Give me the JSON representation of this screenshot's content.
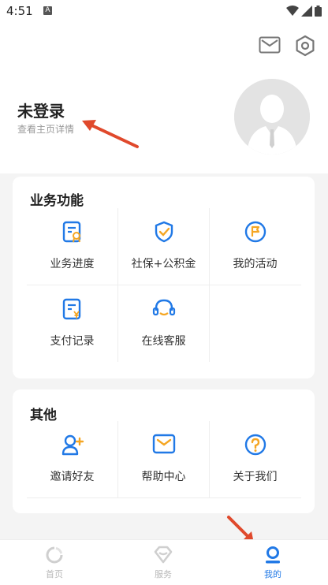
{
  "status_bar": {
    "time": "4:51",
    "a_badge": "A"
  },
  "header": {
    "title": "未登录",
    "subtitle": "查看主页详情"
  },
  "business": {
    "title": "业务功能",
    "items": [
      {
        "label": "业务进度",
        "icon": "certificate-icon"
      },
      {
        "label": "社保+公积金",
        "icon": "shield-check-icon"
      },
      {
        "label": "我的活动",
        "icon": "flag-icon"
      },
      {
        "label": "支付记录",
        "icon": "payment-record-icon"
      },
      {
        "label": "在线客服",
        "icon": "headset-icon"
      }
    ]
  },
  "other": {
    "title": "其他",
    "items": [
      {
        "label": "邀请好友",
        "icon": "add-user-icon"
      },
      {
        "label": "帮助中心",
        "icon": "mail-icon"
      },
      {
        "label": "关于我们",
        "icon": "question-icon"
      }
    ]
  },
  "tabs": [
    {
      "label": "首页",
      "icon": "home-icon",
      "active": false
    },
    {
      "label": "服务",
      "icon": "service-icon",
      "active": false
    },
    {
      "label": "我的",
      "icon": "profile-icon",
      "active": true
    }
  ],
  "colors": {
    "primary": "#2179e6",
    "accent": "#f5a623",
    "annotation": "#e0492c"
  }
}
